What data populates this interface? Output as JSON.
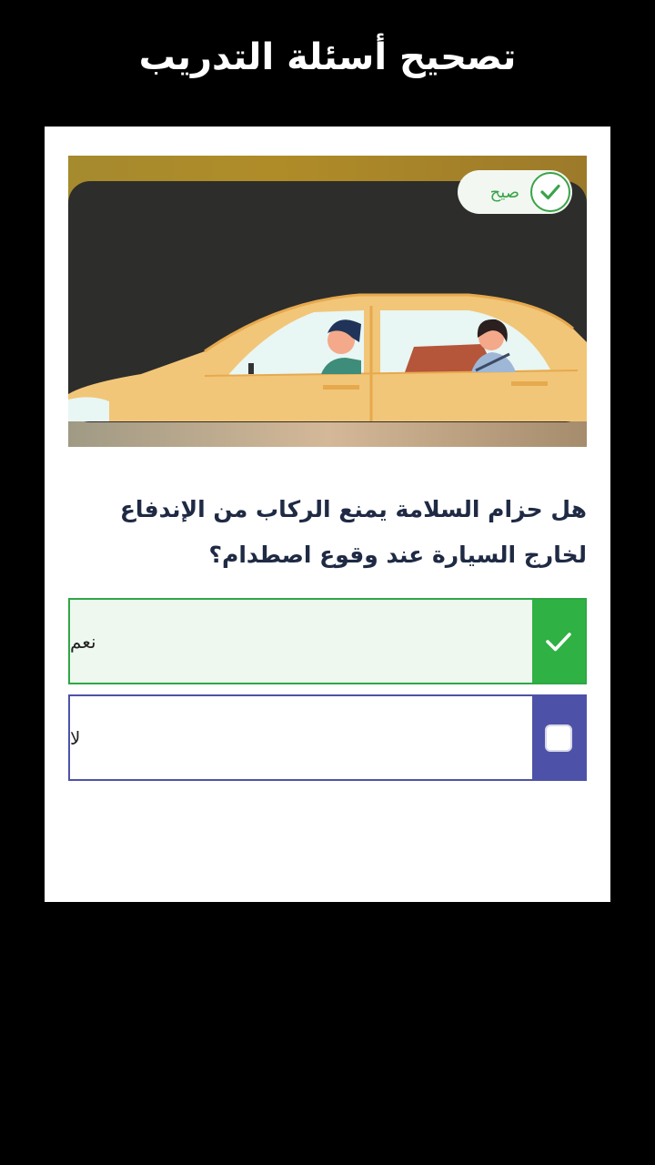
{
  "header": {
    "title": "تصحيح أسئلة التدريب"
  },
  "question_card": {
    "badge": {
      "label": "صيح",
      "icon": "check-circle-icon",
      "color": "#3aa34a"
    },
    "question_text": "هل حزام السلامة يمنع الركاب من الإندفاع لخارج السيارة عند وقوع اصطدام؟",
    "options": [
      {
        "label": "نعم",
        "state": "correct",
        "icon": "check-icon",
        "accent_color": "#2fb143"
      },
      {
        "label": "لا",
        "state": "unselected",
        "icon": "empty-checkbox-icon",
        "accent_color": "#4d52a8"
      }
    ]
  }
}
